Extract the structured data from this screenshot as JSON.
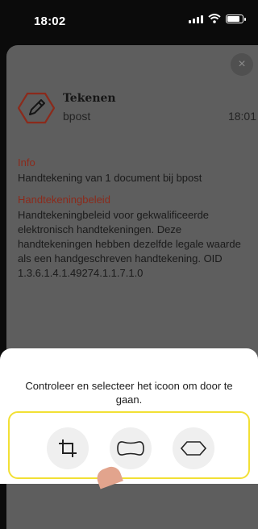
{
  "status_bar": {
    "time": "18:02"
  },
  "dialog": {
    "close_icon": "×",
    "message": {
      "title": "Tekenen",
      "sender": "bpost",
      "time": "18:01",
      "icon": "pencil-in-hexagon-icon"
    },
    "info": {
      "heading": "Info",
      "text": "Handtekening van 1 document bij bpost"
    },
    "policy": {
      "heading": "Handtekeningbeleid",
      "text": "Handtekeningbeleid voor gekwalificeerde elektronisch handtekeningen. Deze handtekeningen hebben dezelfde legale waarde als een handgeschreven handtekening. OID 1.3.6.1.4.1.49274.1.1.7.1.0"
    }
  },
  "selector": {
    "instruction": "Controleer en selecteer het icoon om door te gaan.",
    "options": [
      {
        "icon": "crop-icon"
      },
      {
        "icon": "rounded-capsule-icon"
      },
      {
        "icon": "hexagon-icon"
      }
    ]
  },
  "colors": {
    "heading_accent": "#8b2a1b",
    "frame_highlight": "#f2e035",
    "sheet_overlay": "#5e5e5e"
  }
}
